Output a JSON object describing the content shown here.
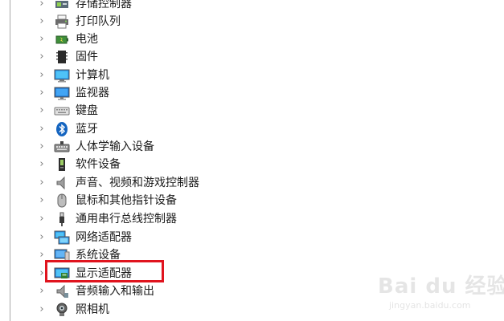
{
  "device_tree": {
    "items": [
      {
        "label": "存储控制器",
        "icon": "storage-controller-icon"
      },
      {
        "label": "打印队列",
        "icon": "printer-icon"
      },
      {
        "label": "电池",
        "icon": "battery-icon"
      },
      {
        "label": "固件",
        "icon": "firmware-icon"
      },
      {
        "label": "计算机",
        "icon": "computer-icon"
      },
      {
        "label": "监视器",
        "icon": "monitor-icon"
      },
      {
        "label": "键盘",
        "icon": "keyboard-icon"
      },
      {
        "label": "蓝牙",
        "icon": "bluetooth-icon"
      },
      {
        "label": "人体学输入设备",
        "icon": "hid-icon"
      },
      {
        "label": "软件设备",
        "icon": "software-device-icon"
      },
      {
        "label": "声音、视频和游戏控制器",
        "icon": "speaker-icon"
      },
      {
        "label": "鼠标和其他指针设备",
        "icon": "mouse-icon"
      },
      {
        "label": "通用串行总线控制器",
        "icon": "usb-icon"
      },
      {
        "label": "网络适配器",
        "icon": "network-adapter-icon"
      },
      {
        "label": "系统设备",
        "icon": "system-device-icon"
      },
      {
        "label": "显示适配器",
        "icon": "display-adapter-icon"
      },
      {
        "label": "音频输入和输出",
        "icon": "audio-io-icon"
      },
      {
        "label": "照相机",
        "icon": "camera-icon"
      }
    ],
    "expand_glyph": "›",
    "highlighted_index": 15
  },
  "colors": {
    "highlight_border": "#e0141e",
    "text": "#1b1b1b",
    "chevron": "#7a7a7a"
  },
  "watermark": {
    "main": "Bai du 经验",
    "sub": "jingyan.baidu.com"
  }
}
